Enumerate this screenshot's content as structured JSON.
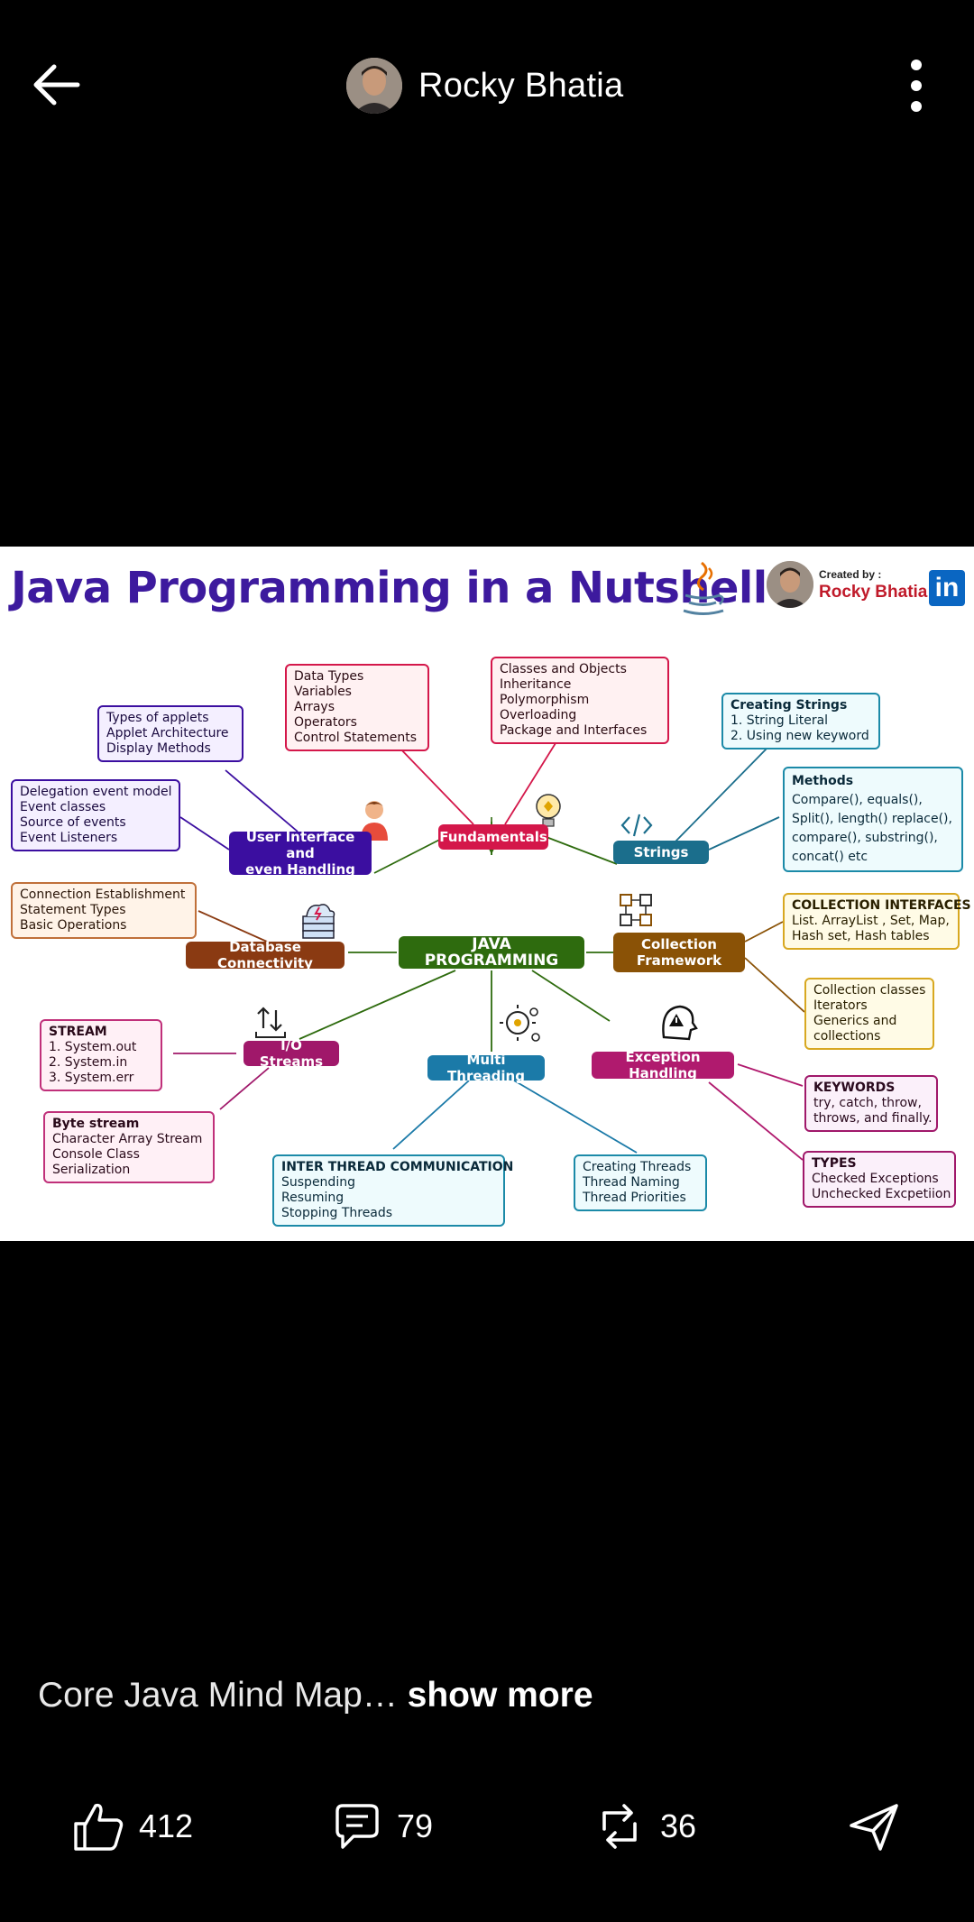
{
  "header": {
    "author_name": "Rocky Bhatia",
    "back_icon": "back-arrow-icon",
    "more_icon": "more-vertical-icon"
  },
  "infographic": {
    "title": "Java Programming in a Nutshell",
    "credit_label": "Created by :",
    "credit_name": "Rocky Bhatia",
    "linkedin": "in",
    "center": "JAVA PROGRAMMING",
    "hubs": {
      "fundamentals": "Fundamentals",
      "ui": [
        "User Interface and",
        "even Handling"
      ],
      "strings": "Strings",
      "collection": [
        "Collection",
        "Framework"
      ],
      "db": "Database Connectivity",
      "io": "I/O Streams",
      "threading": "Multi Threading",
      "exception": "Exception Handling"
    },
    "boxes": {
      "fundamentals_list": [
        "Data Types",
        "Variables",
        "Arrays",
        "Operators",
        "Control Statements"
      ],
      "oop_list": [
        "Classes and Objects",
        "Inheritance",
        "Polymorphism",
        "Overloading",
        "Package and Interfaces"
      ],
      "applets": [
        "Types of applets",
        "Applet Architecture",
        "Display Methods"
      ],
      "events": [
        "Delegation event model",
        "Event classes",
        "Source of events",
        "Event Listeners"
      ],
      "creating_strings": [
        "Creating Strings",
        "1. String Literal",
        "2. Using new keyword"
      ],
      "methods": [
        "Methods",
        "Compare(), equals(),",
        "Split(), length() replace(),",
        "compare(), substring(),",
        "concat() etc"
      ],
      "connection": [
        "Connection Establishment",
        "Statement Types",
        "Basic Operations"
      ],
      "collection_interfaces": [
        "COLLECTION INTERFACES",
        "List. ArrayList , Set, Map,",
        "Hash set, Hash tables"
      ],
      "collection_classes": [
        "Collection classes",
        "Iterators",
        "Generics and",
        "collections"
      ],
      "stream": [
        "STREAM",
        "1. System.out",
        "2. System.in",
        "3. System.err"
      ],
      "byte_stream": [
        "Byte stream",
        "Character Array Stream",
        "Console Class",
        "Serialization"
      ],
      "inter_thread": [
        "INTER THREAD COMMUNICATION",
        "Suspending",
        "Resuming",
        "Stopping Threads"
      ],
      "creating_threads": [
        "Creating Threads",
        "Thread Naming",
        "Thread Priorities"
      ],
      "keywords": [
        "KEYWORDS",
        "try, catch, throw,",
        "throws, and finally."
      ],
      "types": [
        "TYPES",
        "Checked Exceptions",
        "Unchecked Excpetiion"
      ]
    }
  },
  "caption": {
    "text": "Core Java Mind Map…",
    "more": "show more"
  },
  "actions": {
    "likes": "412",
    "comments": "79",
    "reposts": "36"
  },
  "colors": {
    "background": "#000000",
    "title": "#3d1a9e",
    "center": "#2e6b0e",
    "fundamentals": "#d4174a",
    "ui": "#3b0ea0",
    "strings": "#1b6e8c",
    "collection": "#8a5206",
    "db": "#8a3a12",
    "io": "#a0186a",
    "threading": "#1b7aa8",
    "exception": "#b01a6e"
  }
}
